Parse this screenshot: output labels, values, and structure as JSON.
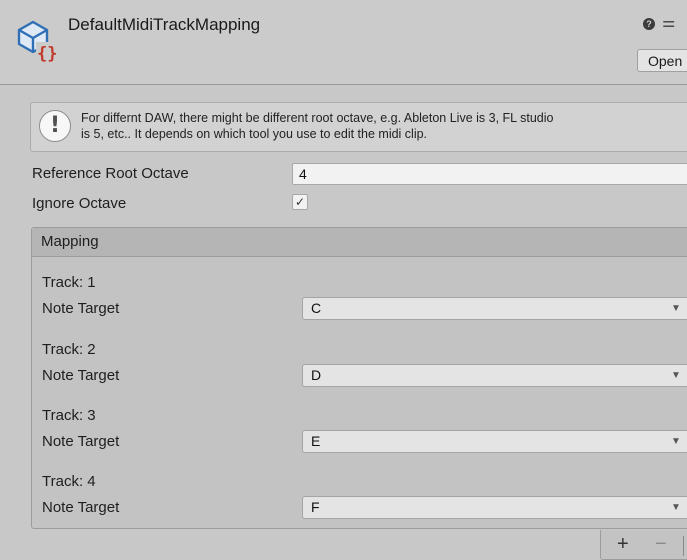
{
  "header": {
    "title": "DefaultMidiTrackMapping",
    "open_label": "Open",
    "help_icon": "help-icon",
    "settings_icon": "settings-sliders-icon",
    "asset_icon": "scriptable-object-icon"
  },
  "helpbox": {
    "icon": "info-icon",
    "text_line1": "For differnt DAW, there might be different root octave, e.g. Ableton Live is 3, FL studio",
    "text_line2": "is 5, etc.. It depends on which tool you use to edit the midi clip."
  },
  "fields": {
    "root_octave_label": "Reference Root Octave",
    "root_octave_value": "4",
    "ignore_octave_label": "Ignore Octave",
    "ignore_octave_checked": "✓"
  },
  "mapping": {
    "title": "Mapping",
    "items": [
      {
        "track": "Track: 1",
        "note_label": "Note Target",
        "note": "C"
      },
      {
        "track": "Track: 2",
        "note_label": "Note Target",
        "note": "D"
      },
      {
        "track": "Track: 3",
        "note_label": "Note Target",
        "note": "E"
      },
      {
        "track": "Track: 4",
        "note_label": "Note Target",
        "note": "F"
      }
    ],
    "add_label": "+",
    "remove_label": "−"
  },
  "colors": {
    "background": "#c8c8c8",
    "icon_blue": "#2f6fb5",
    "icon_red": "#c0392b"
  }
}
